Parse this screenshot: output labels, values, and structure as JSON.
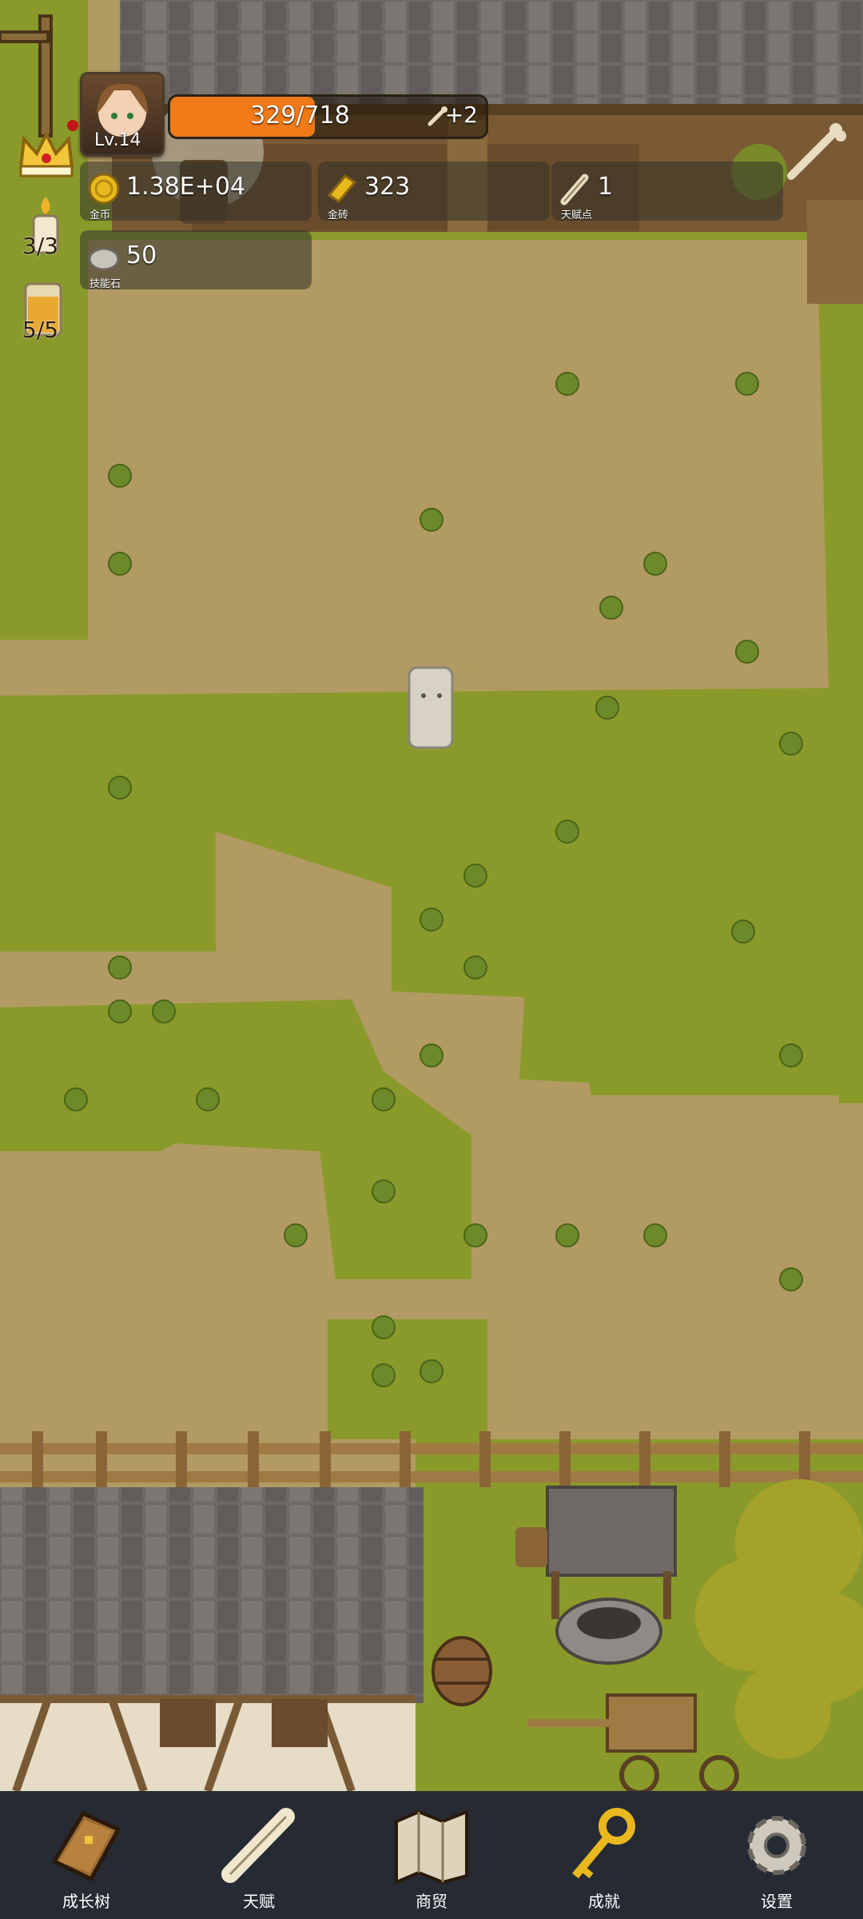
{
  "player": {
    "level": "Lv.14",
    "xp_text": "329/718",
    "xp_fraction": 0.458,
    "bonus": "+2"
  },
  "resources": {
    "gold": {
      "value": "1.38E+04",
      "label": "金币"
    },
    "brick": {
      "value": "323",
      "label": "金砖"
    },
    "talent": {
      "value": "1",
      "label": "天赋点"
    },
    "skillstone": {
      "value": "50",
      "label": "技能石"
    }
  },
  "side": {
    "candle": "3/3",
    "drink": "5/5"
  },
  "nav": {
    "growth": "成长树",
    "talent": "天赋",
    "trade": "商贸",
    "achievement": "成就",
    "settings": "设置"
  },
  "colors": {
    "grass": "#8a9a2a",
    "dirt": "#b29a63",
    "nav_bg": "#252a33",
    "xp_fill": "#f07a18"
  }
}
